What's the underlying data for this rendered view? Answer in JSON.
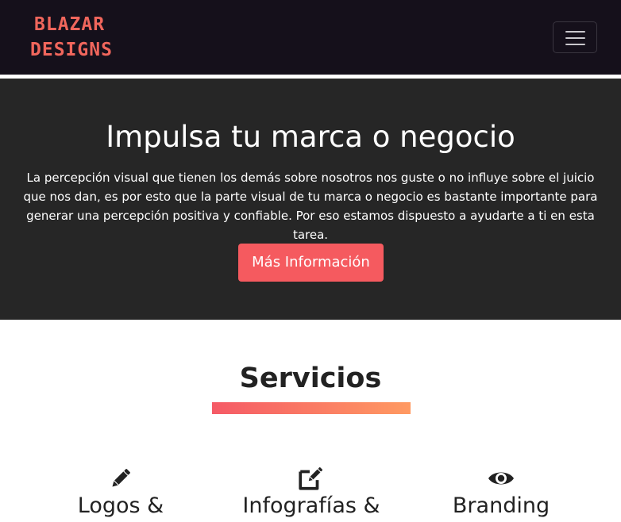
{
  "navbar": {
    "logo": {
      "line1": "BLAZAR",
      "line2": "DESIGNS"
    },
    "toggle_icon": "hamburger-menu-icon"
  },
  "hero": {
    "title": "Impulsa tu marca o negocio",
    "description": "La percepción visual que tienen los demás sobre nosotros nos guste o no influye sobre el juicio que nos dan, es por esto que la parte visual de tu marca o negocio es bastante importante para generar una percepción positiva y confiable. Por eso estamos dispuesto a ayudarte a ti en esta tarea.",
    "button_label": "Más Información"
  },
  "services": {
    "title": "Servicios",
    "items": [
      {
        "icon": "pencil-icon",
        "label": "Logos &"
      },
      {
        "icon": "edit-icon",
        "label": "Infografías &"
      },
      {
        "icon": "eye-icon",
        "label": "Branding"
      }
    ]
  },
  "colors": {
    "navbar_bg": "#15101b",
    "hero_bg": "#262626",
    "accent": "#f55a5f",
    "gradient_start": "#f55a66",
    "gradient_end": "#ff9a62",
    "logo": "#f0665c"
  }
}
